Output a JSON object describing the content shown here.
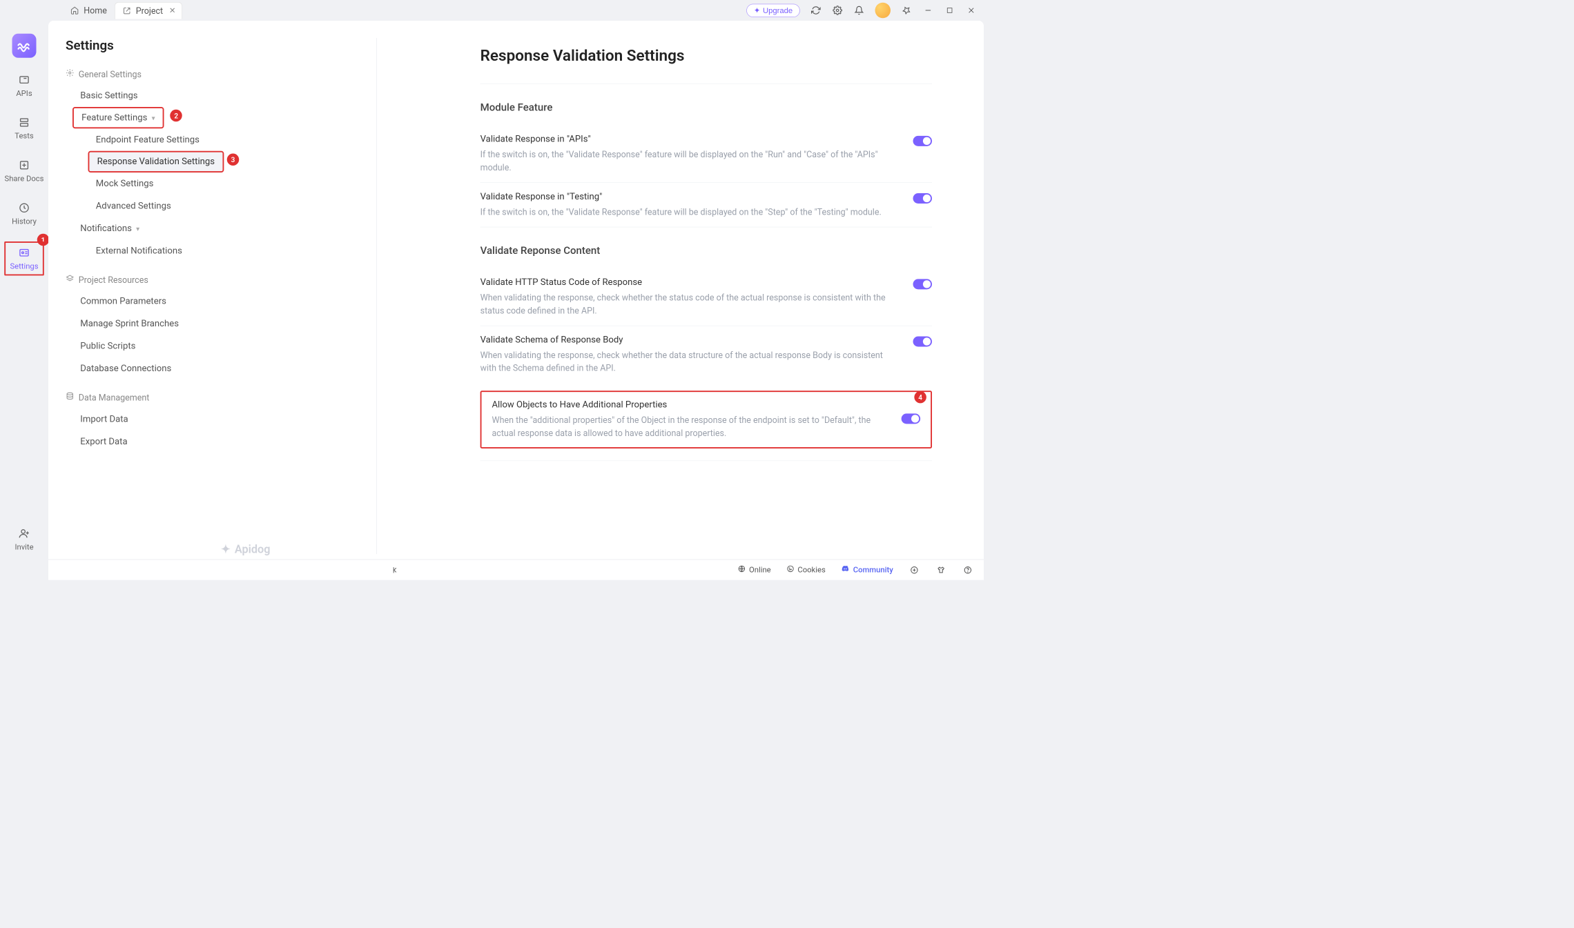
{
  "tabs": {
    "home": "Home",
    "project": "Project"
  },
  "topRight": {
    "upgrade": "Upgrade"
  },
  "leftnav": {
    "apis": "APIs",
    "tests": "Tests",
    "share": "Share Docs",
    "history": "History",
    "settings": "Settings",
    "invite": "Invite"
  },
  "badges": {
    "settings": "1",
    "feature": "2",
    "response": "3",
    "allow": "4"
  },
  "settingsTitle": "Settings",
  "sections": {
    "general": "General Settings",
    "resources": "Project Resources",
    "dataMgmt": "Data Management"
  },
  "items": {
    "basic": "Basic Settings",
    "feature": "Feature Settings",
    "endpointFeature": "Endpoint Feature Settings",
    "responseValidation": "Response Validation Settings",
    "mock": "Mock Settings",
    "advanced": "Advanced Settings",
    "notifications": "Notifications",
    "externalNotifications": "External Notifications",
    "commonParams": "Common Parameters",
    "sprintBranches": "Manage Sprint Branches",
    "publicScripts": "Public Scripts",
    "dbConn": "Database Connections",
    "importData": "Import Data",
    "exportData": "Export Data"
  },
  "content": {
    "title": "Response Validation Settings",
    "moduleFeature": "Module Feature",
    "validateContent": "Validate Reponse Content",
    "rows": {
      "vApis": {
        "label": "Validate Response in \"APIs\"",
        "desc": "If the switch is on, the \"Validate Response\" feature will be displayed on the \"Run\" and \"Case\" of the \"APIs\" module."
      },
      "vTesting": {
        "label": "Validate Response in \"Testing\"",
        "desc": "If the switch is on, the \"Validate Response\" feature will be displayed on the \"Step\" of the \"Testing\" module."
      },
      "vStatus": {
        "label": "Validate HTTP Status Code of Response",
        "desc": "When validating the response, check whether the status code of the actual response is consistent with the status code defined in the API."
      },
      "vSchema": {
        "label": "Validate Schema of Response Body",
        "desc": "When validating the response, check whether the data structure of the actual response Body is consistent with the Schema defined in the API."
      },
      "allowAdditional": {
        "label": "Allow Objects to Have Additional Properties",
        "desc": "When the \"additional properties\" of the Object in the response of the endpoint is set to \"Default\", the actual response data is allowed to have additional properties."
      }
    }
  },
  "status": {
    "online": "Online",
    "cookies": "Cookies",
    "community": "Community"
  },
  "brand": "Apidog"
}
